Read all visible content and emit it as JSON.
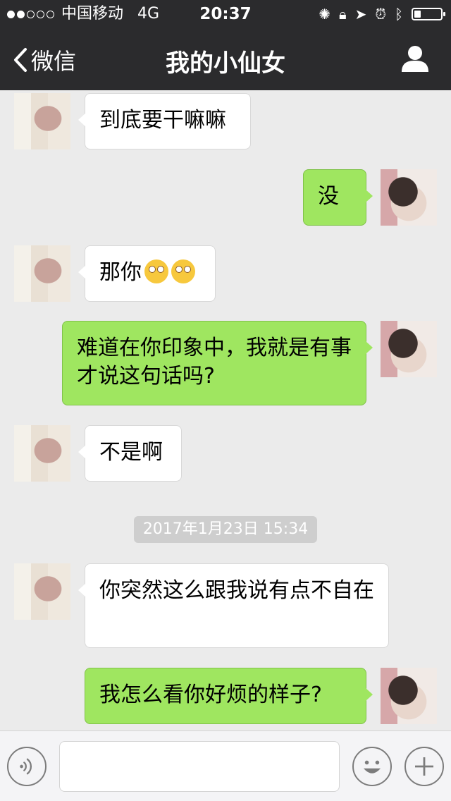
{
  "status_bar": {
    "carrier": "中国移动",
    "network": "4G",
    "time": "20:37",
    "signal_strength": 2,
    "battery_level": 0.25
  },
  "nav": {
    "back_label": "微信",
    "title": "我的小仙女"
  },
  "messages": [
    {
      "from": "her",
      "text": "到底要干嘛嘛"
    },
    {
      "from": "me",
      "text": "没"
    },
    {
      "from": "her",
      "text": "那你",
      "emoji": [
        "flushed-face-icon",
        "flushed-face-icon"
      ]
    },
    {
      "from": "me",
      "text": "难道在你印象中，我就是有事才说这句话吗?"
    },
    {
      "from": "her",
      "text": "不是啊"
    },
    {
      "from": "me",
      "text": "我怎么看你好烦的样子?"
    }
  ],
  "timestamp": "2017年1月23日 15:34",
  "message_after_timestamp": {
    "from": "her",
    "text": "你突然这么跟我说有点不自在"
  },
  "colors": {
    "header_bg": "#2b2b2d",
    "chat_bg": "#ebebeb",
    "my_bubble": "#9fe660",
    "her_bubble": "#ffffff"
  },
  "input": {
    "value": "",
    "placeholder": ""
  }
}
